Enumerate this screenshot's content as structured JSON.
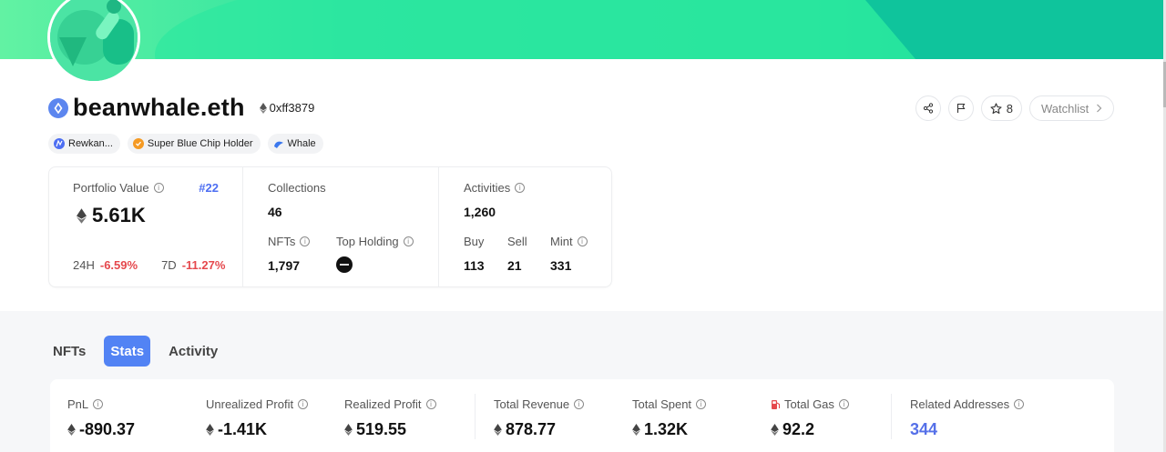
{
  "profile": {
    "name": "beanwhale.eth",
    "address": "0xff3879"
  },
  "tags": [
    {
      "label": "Rewkan...",
      "icon": "rewkan-icon",
      "color": "#4d6ef2"
    },
    {
      "label": "Super Blue Chip Holder",
      "icon": "blue-chip-icon",
      "color": "#f59a23"
    },
    {
      "label": "Whale",
      "icon": "whale-icon",
      "color": "#3b78ee"
    }
  ],
  "actions": {
    "star_count": "8",
    "watchlist_label": "Watchlist"
  },
  "summary": {
    "portfolio_label": "Portfolio Value",
    "portfolio_rank": "#22",
    "portfolio_value": "5.61K",
    "change_24h_label": "24H",
    "change_24h_value": "-6.59%",
    "change_7d_label": "7D",
    "change_7d_value": "-11.27%",
    "collections_label": "Collections",
    "collections_value": "46",
    "nfts_label": "NFTs",
    "nfts_value": "1,797",
    "top_holding_label": "Top Holding",
    "activities_label": "Activities",
    "activities_value": "1,260",
    "buy_label": "Buy",
    "buy_value": "113",
    "sell_label": "Sell",
    "sell_value": "21",
    "mint_label": "Mint",
    "mint_value": "331"
  },
  "tabs": [
    {
      "label": "NFTs",
      "active": false
    },
    {
      "label": "Stats",
      "active": true
    },
    {
      "label": "Activity",
      "active": false
    }
  ],
  "stats": {
    "pnl_label": "PnL",
    "pnl_value": "-890.37",
    "unrealized_label": "Unrealized Profit",
    "unrealized_value": "-1.41K",
    "realized_label": "Realized Profit",
    "realized_value": "519.55",
    "revenue_label": "Total Revenue",
    "revenue_value": "878.77",
    "spent_label": "Total Spent",
    "spent_value": "1.32K",
    "gas_label": "Total Gas",
    "gas_value": "92.2",
    "related_label": "Related Addresses",
    "related_value": "344"
  },
  "colors": {
    "accent": "#5283f4",
    "negative": "#e5484d",
    "banner": "#25e39b",
    "link": "#5570e8"
  }
}
